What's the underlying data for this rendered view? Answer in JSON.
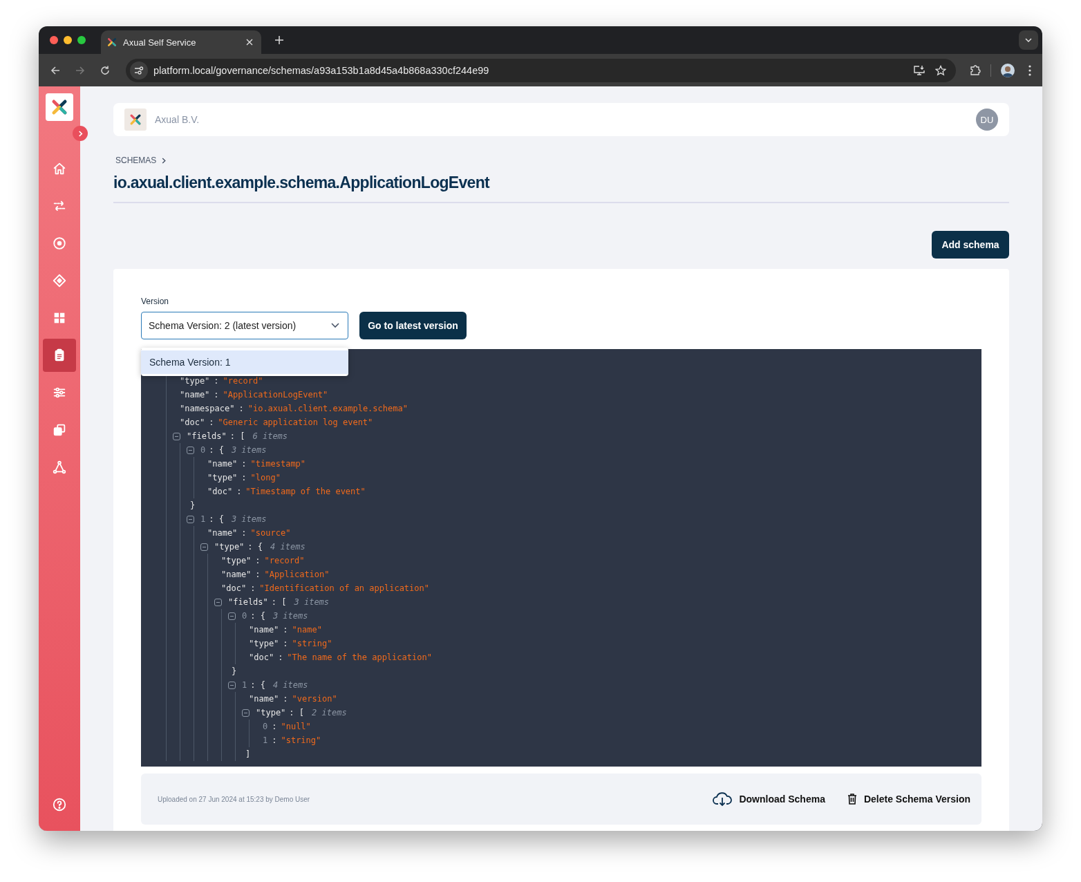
{
  "browser": {
    "tab_title": "Axual Self Service",
    "url": "platform.local/governance/schemas/a93a153b1a8d45a4b868a330cf244e99"
  },
  "sidebar": {
    "items": [
      {
        "selected": false
      },
      {
        "selected": false
      },
      {
        "selected": false
      },
      {
        "selected": false
      },
      {
        "selected": false
      },
      {
        "selected": true
      },
      {
        "selected": false
      },
      {
        "selected": false
      },
      {
        "selected": false
      }
    ]
  },
  "header": {
    "organization": "Axual B.V.",
    "user_initials": "DU"
  },
  "breadcrumb": [
    "SCHEMAS"
  ],
  "title": "io.axual.client.example.schema.ApplicationLogEvent",
  "add_button": "Add schema",
  "version": {
    "label": "Version",
    "value": "Schema Version: 2 (latest version)",
    "go_button": "Go to latest version",
    "options": [
      {
        "label": "Schema Version: 1",
        "selected": true
      }
    ]
  },
  "code_view": {
    "lines": [
      {
        "key": "\"type\"",
        "sep": ":",
        "value": "\"record\""
      },
      {
        "key": "\"name\"",
        "sep": ":",
        "value": "\"ApplicationLogEvent\""
      },
      {
        "key": "\"namespace\"",
        "sep": ":",
        "value": "\"io.axual.client.example.schema\""
      },
      {
        "key": "\"doc\"",
        "sep": ":",
        "value": "\"Generic application log event\""
      },
      {
        "key": "\"fields\"",
        "sep": ": [",
        "count": "6 items",
        "expanded": true,
        "children": [
          {
            "key": "0",
            "kind": "index",
            "sep": ": {",
            "count": "3 items",
            "expanded": true,
            "close": "}",
            "children": [
              {
                "key": "\"name\"",
                "sep": ":",
                "value": "\"timestamp\""
              },
              {
                "key": "\"type\"",
                "sep": ":",
                "value": "\"long\""
              },
              {
                "key": "\"doc\"",
                "sep": ":",
                "value": "\"Timestamp of the event\""
              }
            ]
          },
          {
            "key": "1",
            "kind": "index",
            "sep": ": {",
            "count": "3 items",
            "expanded": true,
            "children": [
              {
                "key": "\"name\"",
                "sep": ":",
                "value": "\"source\""
              },
              {
                "key": "\"type\"",
                "sep": ": {",
                "count": "4 items",
                "expanded": true,
                "children": [
                  {
                    "key": "\"type\"",
                    "sep": ":",
                    "value": "\"record\""
                  },
                  {
                    "key": "\"name\"",
                    "sep": ":",
                    "value": "\"Application\""
                  },
                  {
                    "key": "\"doc\"",
                    "sep": ":",
                    "value": "\"Identification of an application\""
                  },
                  {
                    "key": "\"fields\"",
                    "sep": ": [",
                    "count": "3 items",
                    "expanded": true,
                    "children": [
                      {
                        "key": "0",
                        "kind": "index",
                        "sep": ": {",
                        "count": "3 items",
                        "expanded": true,
                        "close": "}",
                        "children": [
                          {
                            "key": "\"name\"",
                            "sep": ":",
                            "value": "\"name\""
                          },
                          {
                            "key": "\"type\"",
                            "sep": ":",
                            "value": "\"string\""
                          },
                          {
                            "key": "\"doc\"",
                            "sep": ":",
                            "value": "\"The name of the application\""
                          }
                        ]
                      },
                      {
                        "key": "1",
                        "kind": "index",
                        "sep": ": {",
                        "count": "4 items",
                        "expanded": true,
                        "children": [
                          {
                            "key": "\"name\"",
                            "sep": ":",
                            "value": "\"version\""
                          },
                          {
                            "key": "\"type\"",
                            "sep": ": [",
                            "count": "2 items",
                            "expanded": true,
                            "close": "]",
                            "children": [
                              {
                                "key": "0",
                                "kind": "index",
                                "sep": ":",
                                "value": "\"null\""
                              },
                              {
                                "key": "1",
                                "kind": "index",
                                "sep": ":",
                                "value": "\"string\""
                              }
                            ]
                          }
                        ]
                      }
                    ]
                  }
                ]
              }
            ]
          }
        ]
      }
    ]
  },
  "footer": {
    "uploaded": "Uploaded on 27 Jun 2024 at 15:23 by Demo User",
    "download_button": "Download Schema",
    "delete_button": "Delete Schema Version"
  }
}
